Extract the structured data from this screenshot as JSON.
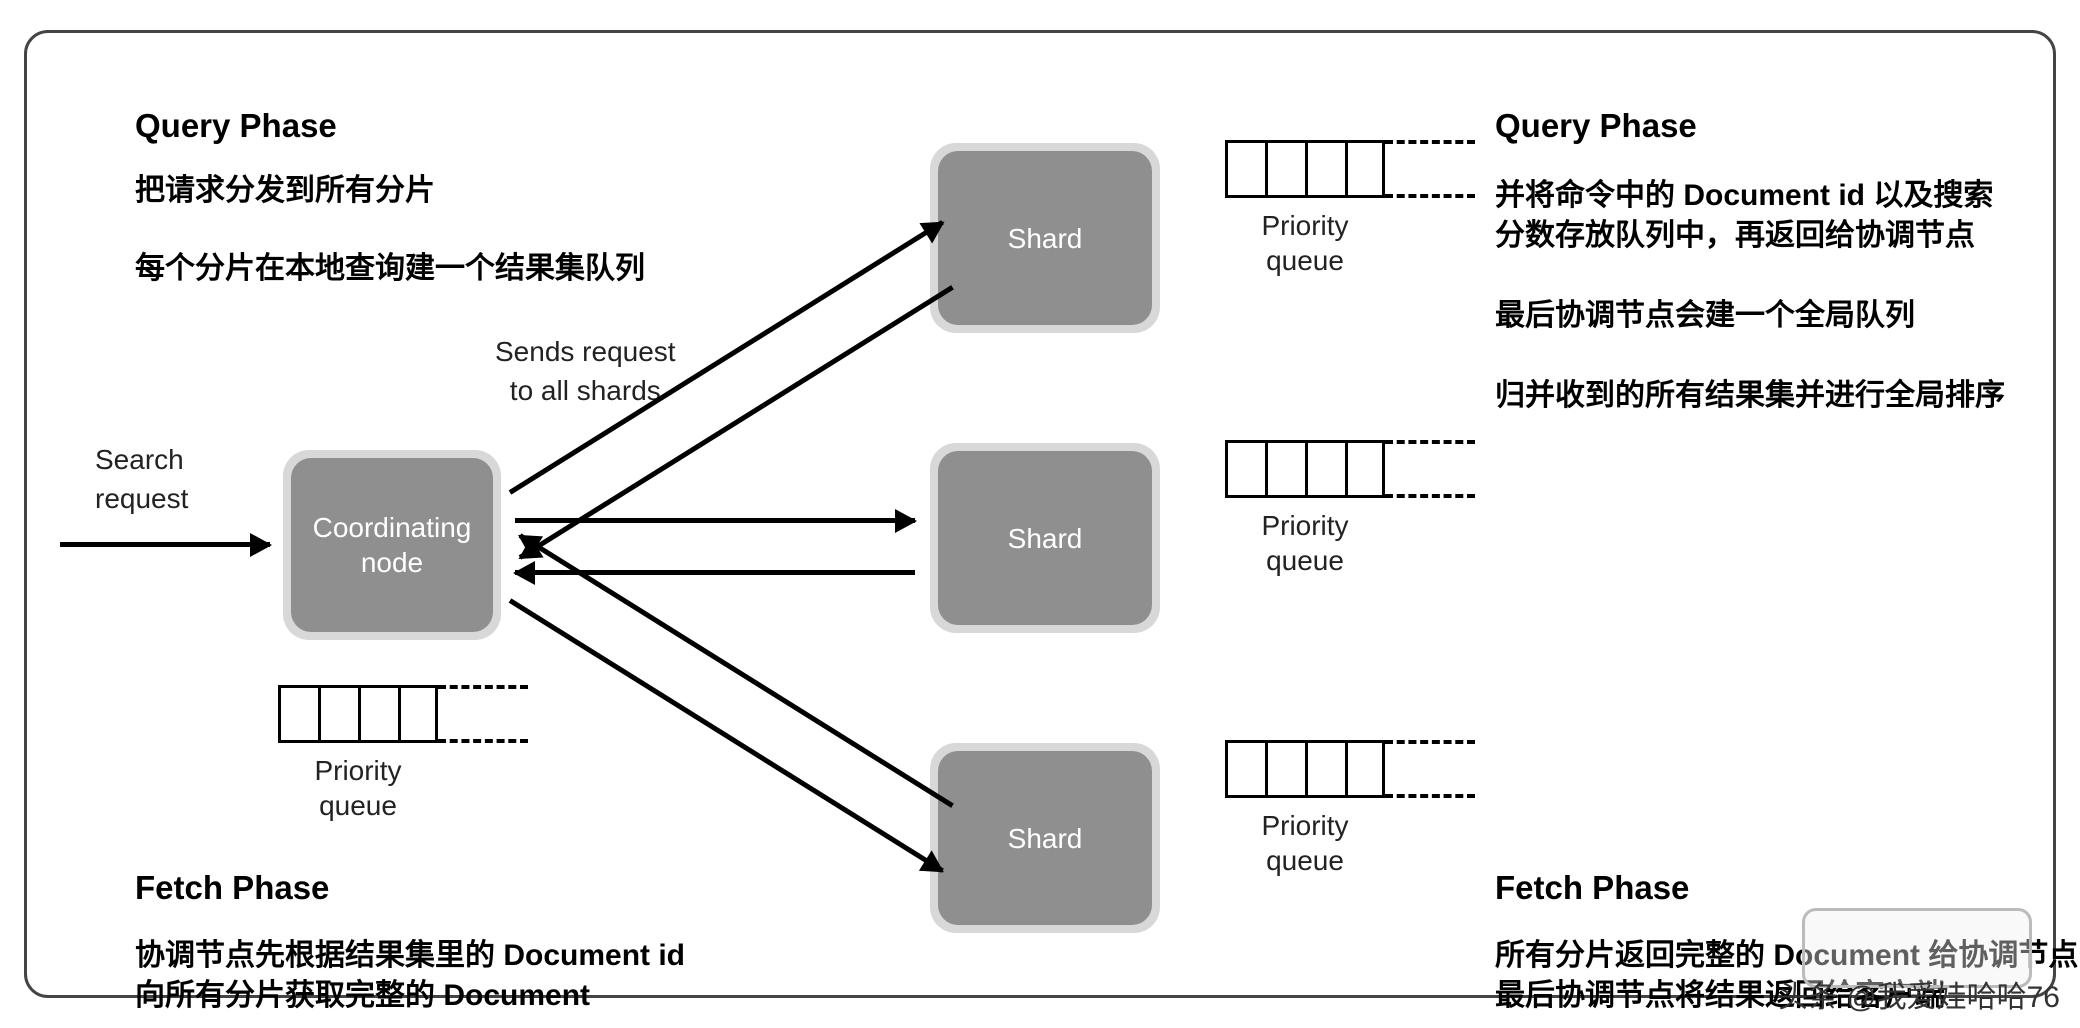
{
  "left": {
    "query_phase_title": "Query Phase",
    "query_line1": "把请求分发到所有分片",
    "query_line2": "每个分片在本地查询建一个结果集队列",
    "fetch_phase_title": "Fetch Phase",
    "fetch_line1": "协调节点先根据结果集里的 Document id",
    "fetch_line2": "向所有分片获取完整的 Document"
  },
  "right": {
    "query_phase_title": "Query Phase",
    "query_line1": "并将命令中的 Document id 以及搜索",
    "query_line2": "分数存放队列中，再返回给协调节点",
    "query_line3": "最后协调节点会建一个全局队列",
    "query_line4": "归并收到的所有结果集并进行全局排序",
    "fetch_phase_title": "Fetch Phase",
    "fetch_line1": "所有分片返回完整的 Document 给协调节点",
    "fetch_line2": "最后协调节点将结果返回给客户端"
  },
  "annotations": {
    "search_request": "Search\nrequest",
    "sends_request": "Sends request\nto all shards"
  },
  "nodes": {
    "coordinating": "Coordinating\nnode",
    "shard": "Shard"
  },
  "queue_label": "Priority\nqueue",
  "watermark": "头条 @我爱娃哈哈76"
}
